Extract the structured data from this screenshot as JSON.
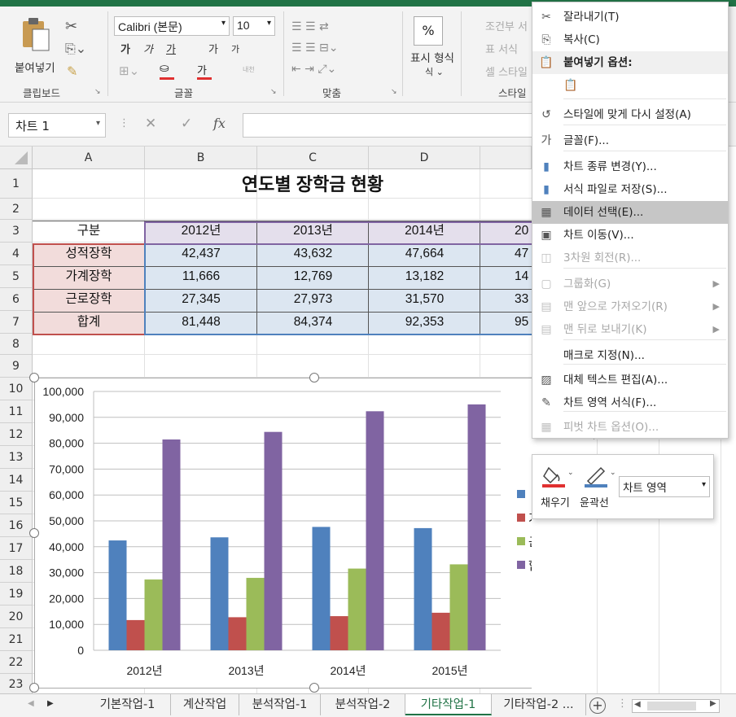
{
  "ribbon": {
    "clipboard": {
      "paste_label": "붙여넣기",
      "group_label": "클립보드"
    },
    "font": {
      "font_name": "Calibri (본문)",
      "font_size": "10",
      "bold": "가",
      "italic": "가",
      "underline": "가",
      "grow": "가",
      "shrink": "가",
      "font_color": "가",
      "phonetic": "내천",
      "group_label": "글꼴"
    },
    "align": {
      "group_label": "맞춤"
    },
    "number": {
      "percent": "%",
      "display_format": "표시 형식",
      "group_label": ""
    },
    "styles": {
      "conditional": "조건부 서",
      "table": "표 서식",
      "cell": "셀 스타일",
      "group_label": "스타일"
    }
  },
  "formula_bar": {
    "name_box": "차트 1",
    "cancel": "✕",
    "enter": "✓",
    "fx": "fx",
    "value": ""
  },
  "sheet": {
    "columns": [
      "A",
      "B",
      "C",
      "D"
    ],
    "rows": [
      "1",
      "2",
      "3",
      "4",
      "5",
      "6",
      "7",
      "8",
      "9",
      "10",
      "11",
      "12",
      "13",
      "14",
      "15",
      "16",
      "17",
      "18",
      "19",
      "20",
      "21",
      "22",
      "23"
    ],
    "title": "연도별 장학금 현황",
    "header_row": [
      "구분",
      "2012년",
      "2013년",
      "2014년",
      "20"
    ],
    "data_rows": [
      [
        "성적장학",
        "42,437",
        "43,632",
        "47,664",
        "47"
      ],
      [
        "가계장학",
        "11,666",
        "12,769",
        "13,182",
        "14"
      ],
      [
        "근로장학",
        "27,345",
        "27,973",
        "31,570",
        "33"
      ],
      [
        "합계",
        "81,448",
        "84,374",
        "92,353",
        "95"
      ]
    ]
  },
  "chart_data": {
    "type": "bar",
    "categories": [
      "2012년",
      "2013년",
      "2014년",
      "2015년"
    ],
    "series": [
      {
        "name": "성적장학",
        "values": [
          42437,
          43632,
          47664,
          47200
        ],
        "color": "#4f81bd"
      },
      {
        "name": "가계장학",
        "values": [
          11666,
          12769,
          13182,
          14500
        ],
        "color": "#c0504d"
      },
      {
        "name": "근로장학",
        "values": [
          27345,
          27973,
          31570,
          33200
        ],
        "color": "#9bbb59"
      },
      {
        "name": "합계",
        "values": [
          81448,
          84374,
          92353,
          95000
        ],
        "color": "#8064a2"
      }
    ],
    "y_ticks": [
      "100,000",
      "90,000",
      "80,000",
      "70,000",
      "60,000",
      "50,000",
      "40,000",
      "30,000",
      "20,000",
      "10,000",
      "0"
    ],
    "ylim": [
      0,
      100000
    ],
    "grid": true,
    "legend_position": "right",
    "legend_visible": [
      "",
      "가계장학",
      "근로장학",
      "합계"
    ]
  },
  "context_menu": {
    "items": [
      {
        "label": "잘라내기(T)",
        "icon": "scissors-icon",
        "glyph": "✂",
        "enabled": true
      },
      {
        "label": "복사(C)",
        "icon": "copy-icon",
        "glyph": "⎘",
        "enabled": true
      },
      {
        "label": "붙여넣기 옵션:",
        "icon": "paste-icon",
        "glyph": "📋",
        "enabled": true,
        "bold": true
      },
      {
        "label": "",
        "icon": "paste-option-icon",
        "glyph": "📋",
        "enabled": true
      },
      {
        "label": "스타일에 맞게 다시 설정(A)",
        "icon": "reset-style-icon",
        "glyph": "↺",
        "enabled": true
      },
      {
        "label": "글꼴(F)...",
        "icon": "font-icon",
        "glyph": "가",
        "enabled": true
      },
      {
        "label": "차트 종류 변경(Y)...",
        "icon": "chart-type-icon",
        "glyph": "▮",
        "enabled": true
      },
      {
        "label": "서식 파일로 저장(S)...",
        "icon": "save-template-icon",
        "glyph": "▮",
        "enabled": true
      },
      {
        "label": "데이터 선택(E)...",
        "icon": "select-data-icon",
        "glyph": "▦",
        "enabled": true,
        "highlight": true
      },
      {
        "label": "차트 이동(V)...",
        "icon": "move-chart-icon",
        "glyph": "▣",
        "enabled": true
      },
      {
        "label": "3차원 회전(R)...",
        "icon": "rotate-3d-icon",
        "glyph": "◫",
        "enabled": false
      },
      {
        "label": "그룹화(G)",
        "icon": "group-icon",
        "glyph": "▢",
        "enabled": false,
        "submenu": true
      },
      {
        "label": "맨 앞으로 가져오기(R)",
        "icon": "bring-front-icon",
        "glyph": "▤",
        "enabled": false,
        "submenu": true
      },
      {
        "label": "맨 뒤로 보내기(K)",
        "icon": "send-back-icon",
        "glyph": "▤",
        "enabled": false,
        "submenu": true
      },
      {
        "label": "매크로 지정(N)...",
        "icon": "",
        "glyph": "",
        "enabled": true
      },
      {
        "label": "대체 텍스트 편집(A)...",
        "icon": "alt-text-icon",
        "glyph": "▨",
        "enabled": true
      },
      {
        "label": "차트 영역 서식(F)...",
        "icon": "format-chart-area-icon",
        "glyph": "✎",
        "enabled": true
      },
      {
        "label": "피벗 차트 옵션(O)...",
        "icon": "pivot-chart-icon",
        "glyph": "▦",
        "enabled": false
      }
    ]
  },
  "mini_toolbar": {
    "fill": "채우기",
    "outline": "윤곽선",
    "element": "차트 영역"
  },
  "tabs": [
    "기본작업-1",
    "계산작업",
    "분석작업-1",
    "분석작업-2",
    "기타작업-1",
    "기타작업-2 ..."
  ],
  "active_tab": 4
}
